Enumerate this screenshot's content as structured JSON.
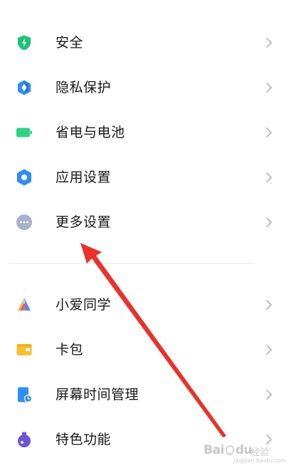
{
  "settings": {
    "group1": [
      {
        "label": "安全",
        "icon": "shield-icon",
        "color": "#1ec27a"
      },
      {
        "label": "隐私保护",
        "icon": "privacy-icon",
        "color": "#2f8ff0"
      },
      {
        "label": "省电与电池",
        "icon": "battery-icon",
        "color": "#2ed185"
      },
      {
        "label": "应用设置",
        "icon": "gear-icon",
        "color": "#2f8ff0"
      },
      {
        "label": "更多设置",
        "icon": "more-icon",
        "color": "#a9b2cc"
      }
    ],
    "group2": [
      {
        "label": "小爱同学",
        "icon": "xiaoai-icon",
        "color": "#e85a8a"
      },
      {
        "label": "卡包",
        "icon": "wallet-icon",
        "color": "#f6c02e"
      },
      {
        "label": "屏幕时间管理",
        "icon": "screen-time-icon",
        "color": "#2f8ff0"
      },
      {
        "label": "特色功能",
        "icon": "special-features-icon",
        "color": "#6b56d8"
      }
    ]
  },
  "annotation": {
    "color": "#e8322b"
  },
  "watermark": {
    "brand": "Bai",
    "brand2": "du",
    "sub": "经验",
    "url": "jingyan.baidu.com"
  }
}
